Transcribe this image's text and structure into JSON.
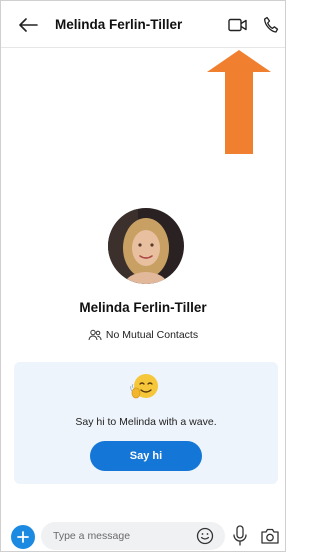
{
  "header": {
    "title": "Melinda Ferlin-Tiller",
    "back_icon": "arrow-left-icon",
    "video_icon": "video-camera-icon",
    "call_icon": "phone-icon"
  },
  "profile": {
    "name": "Melinda Ferlin-Tiller",
    "mutual_contacts": "No Mutual Contacts"
  },
  "wave_card": {
    "message": "Say hi to Melinda with a wave.",
    "button_label": "Say hi",
    "icon": "wave-emoji-icon"
  },
  "composer": {
    "placeholder": "Type a message",
    "add_icon": "plus-icon",
    "emoji_icon": "emoji-icon",
    "mic_icon": "microphone-icon",
    "camera_icon": "camera-icon"
  },
  "colors": {
    "accent": "#1476d6",
    "annotation_arrow": "#f07f2f",
    "card_bg": "#eef4fb"
  }
}
